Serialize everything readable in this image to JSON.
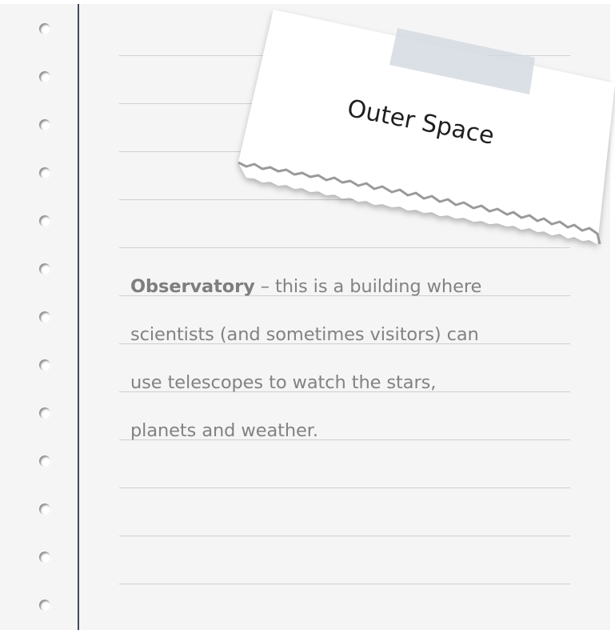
{
  "note": {
    "heading": "Outer Space",
    "term": "Observatory",
    "definition_lines": [
      " – this is a building where",
      "scientists (and sometimes visitors) can",
      "use telescopes to watch the stars,",
      "planets and weather."
    ]
  },
  "colors": {
    "paper": "#f5f5f5",
    "margin_line": "#3f4a5d",
    "rule": "#cfcfcf",
    "text": "#828282",
    "card": "#ffffff",
    "tape": "#d5dae2"
  }
}
